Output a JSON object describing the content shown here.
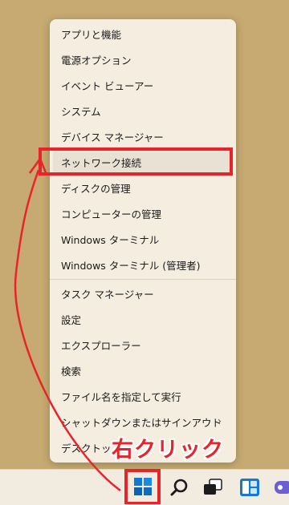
{
  "menu": {
    "items": [
      {
        "label": "アプリと機能"
      },
      {
        "label": "電源オプション"
      },
      {
        "label": "イベント ビューアー"
      },
      {
        "label": "システム"
      },
      {
        "label": "デバイス マネージャー"
      },
      {
        "label": "ネットワーク接続"
      },
      {
        "label": "ディスクの管理"
      },
      {
        "label": "コンピューターの管理"
      },
      {
        "label": "Windows ターミナル"
      },
      {
        "label": "Windows ターミナル (管理者)"
      },
      {
        "label": "タスク マネージャー"
      },
      {
        "label": "設定"
      },
      {
        "label": "エクスプローラー"
      },
      {
        "label": "検索"
      },
      {
        "label": "ファイル名を指定して実行"
      },
      {
        "label": "シャットダウンまたはサインアウト"
      },
      {
        "label": "デスクトップ"
      }
    ],
    "submenu_chevron": "›"
  },
  "annotation": {
    "callout_text": "右クリック",
    "color": "#e8232a"
  },
  "taskbar": {
    "icons": [
      "start-icon",
      "search-icon",
      "task-view-icon",
      "widgets-icon",
      "chat-icon"
    ]
  },
  "colors": {
    "desktop": "#c6aa72",
    "menu_bg": "#f4ede0",
    "accent_blue": "#0f6cbd"
  }
}
